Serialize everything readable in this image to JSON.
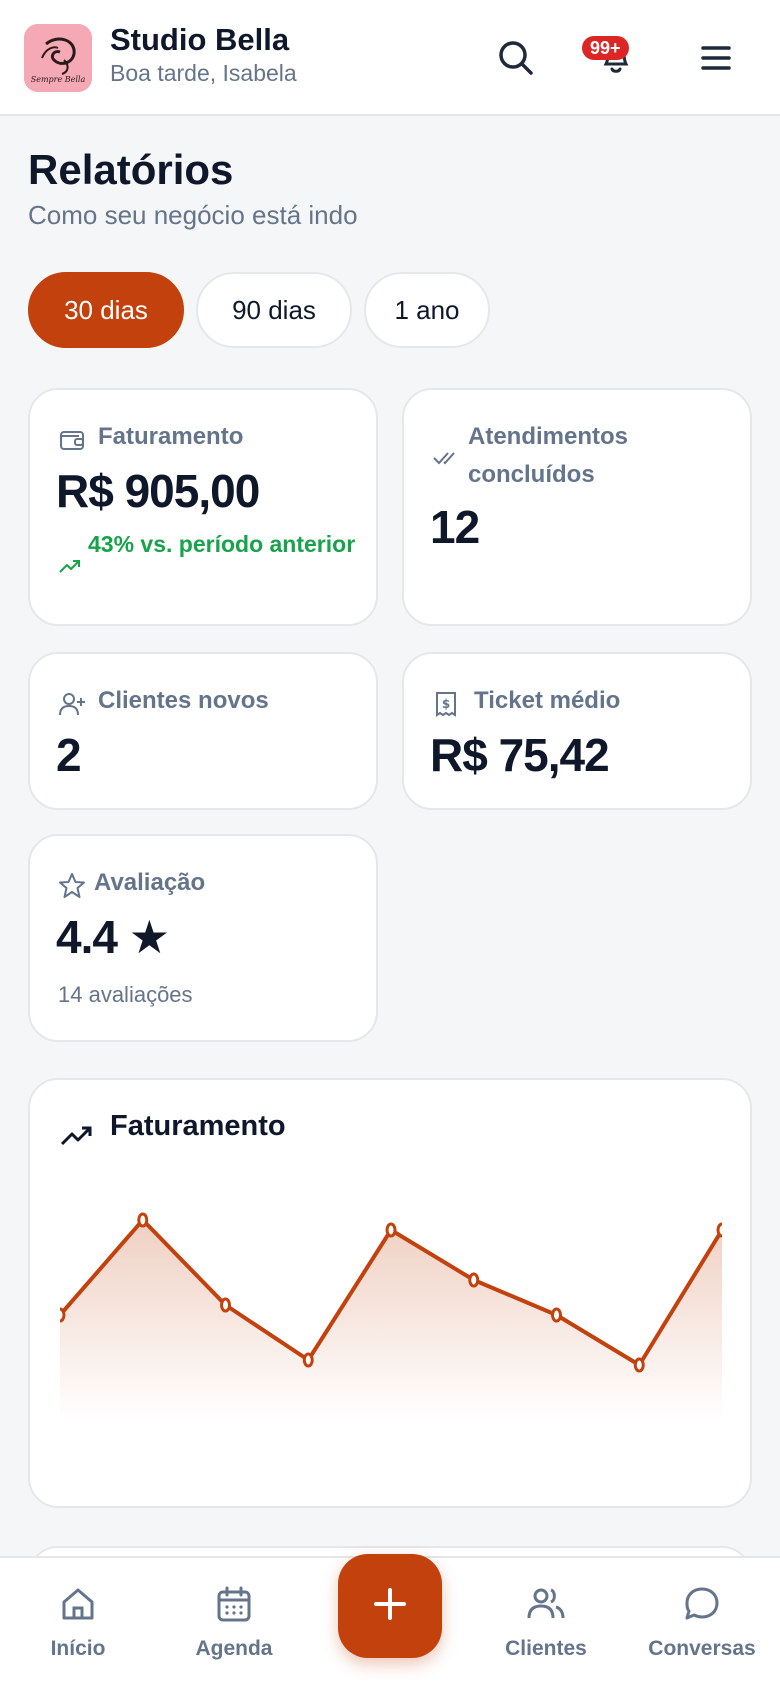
{
  "header": {
    "title": "Studio Bella",
    "subtitle": "Boa tarde, Isabela",
    "logo_text": "Sempre Bella",
    "notification_badge": "99+"
  },
  "page": {
    "title": "Relatórios",
    "subtitle": "Como seu negócio está indo"
  },
  "periods": [
    {
      "label": "30 dias",
      "active": true
    },
    {
      "label": "90 dias",
      "active": false
    },
    {
      "label": "1 ano",
      "active": false
    }
  ],
  "stats": {
    "revenue": {
      "label": "Faturamento",
      "value": "R$ 905,00",
      "trend": "43% vs. período anterior",
      "icon": "wallet-icon"
    },
    "completed": {
      "label": "Atendimentos concluídos",
      "value": "12",
      "icon": "double-check-icon"
    },
    "new_clients": {
      "label": "Clientes novos",
      "value": "2",
      "icon": "user-plus-icon"
    },
    "avg_ticket": {
      "label": "Ticket médio",
      "value": "R$ 75,42",
      "icon": "receipt-icon"
    },
    "rating": {
      "label": "Avaliação",
      "value": "4.4 ★",
      "count": "14 avaliações",
      "icon": "star-icon"
    }
  },
  "chart_card": {
    "title": "Faturamento",
    "icon": "trending-up-icon"
  },
  "chart_data": {
    "type": "area",
    "title": "Faturamento",
    "x": [
      1,
      2,
      3,
      4,
      5,
      6,
      7,
      8,
      9
    ],
    "values": [
      105,
      200,
      115,
      60,
      190,
      140,
      105,
      55,
      190
    ],
    "ylim": [
      0,
      220
    ],
    "grid": false,
    "color": "#c2410c"
  },
  "bottom_nav": {
    "items": [
      {
        "label": "Início",
        "icon": "home-icon"
      },
      {
        "label": "Agenda",
        "icon": "calendar-icon"
      },
      {
        "label": "Clientes",
        "icon": "users-icon"
      },
      {
        "label": "Conversas",
        "icon": "chat-icon"
      }
    ],
    "fab_icon": "plus-icon"
  },
  "colors": {
    "accent": "#c2410c",
    "positive": "#16a34a",
    "badge": "#dc2626"
  }
}
